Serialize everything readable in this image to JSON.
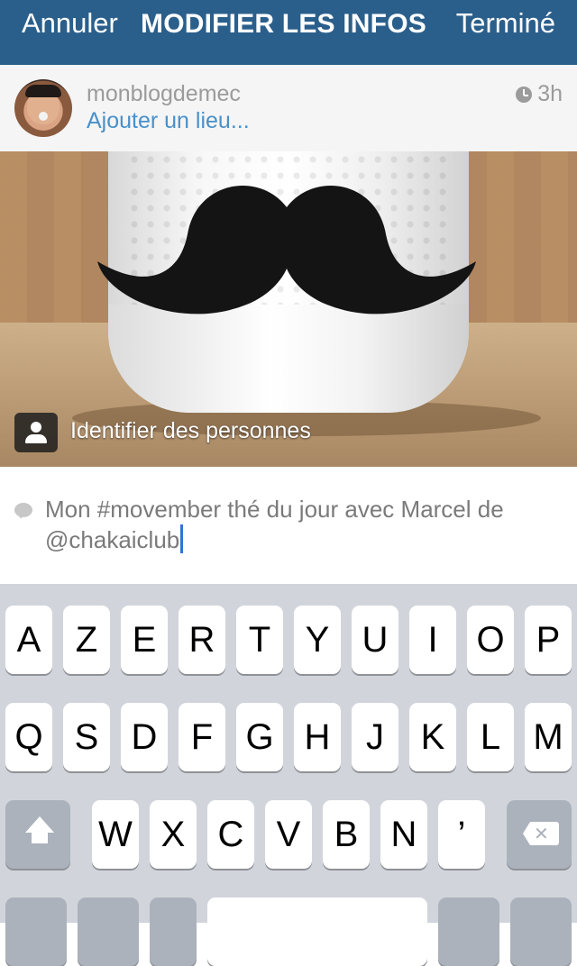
{
  "header": {
    "cancel": "Annuler",
    "title": "MODIFIER LES INFOS",
    "done": "Terminé",
    "bg_color": "#2b5f8b"
  },
  "post": {
    "username": "monblogdemec",
    "add_place": "Ajouter un lieu...",
    "time": "3h",
    "tag_people": "Identifier des personnes"
  },
  "caption": {
    "text": "Mon #movember thé du jour avec Marcel de @chakaiclub"
  },
  "keyboard": {
    "row1": [
      "A",
      "Z",
      "E",
      "R",
      "T",
      "Y",
      "U",
      "I",
      "O",
      "P"
    ],
    "row2": [
      "Q",
      "S",
      "D",
      "F",
      "G",
      "H",
      "J",
      "K",
      "L",
      "M"
    ],
    "row3": [
      "W",
      "X",
      "C",
      "V",
      "B",
      "N",
      "’"
    ]
  },
  "icons": [
    "clock-icon",
    "tag-person-icon",
    "comment-bubble-icon",
    "shift-icon",
    "delete-icon"
  ]
}
